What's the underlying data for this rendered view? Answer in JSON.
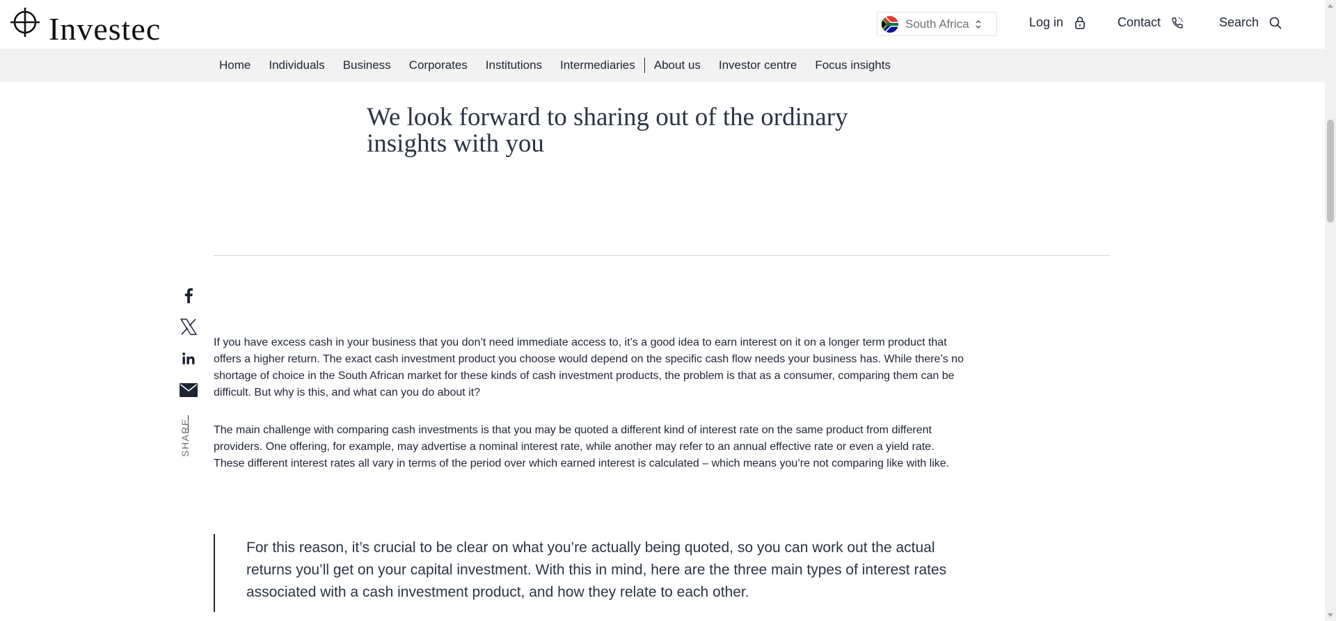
{
  "header": {
    "logo_text": "Investec",
    "region": {
      "label": "South Africa",
      "flag_icon": "south-africa-flag-icon"
    },
    "login_label": "Log in",
    "contact_label": "Contact",
    "search_label": "Search"
  },
  "nav": {
    "items": [
      {
        "label": "Home"
      },
      {
        "label": "Individuals"
      },
      {
        "label": "Business"
      },
      {
        "label": "Corporates"
      },
      {
        "label": "Institutions"
      },
      {
        "label": "Intermediaries"
      },
      {
        "label": "About us"
      },
      {
        "label": "Investor centre"
      },
      {
        "label": "Focus insights"
      }
    ]
  },
  "article": {
    "headline": "We look forward to sharing out of the ordinary insights with you",
    "paragraphs": [
      "If you have excess cash in your business that you don’t need immediate access to, it’s a good idea to earn interest on it on a longer term product that offers a higher return. The exact cash investment product you choose would depend on the specific cash flow needs your business has. While there’s no shortage of choice in the South African market for these kinds of cash investment products, the problem is that as a consumer, comparing them can be difficult. But why is this, and what can you do about it?",
      "The main challenge with comparing cash investments is that you may be quoted a different kind of interest rate on the same product from different providers. One offering, for example, may advertise a nominal interest rate, while another may refer to an annual effective rate or even a yield rate. These different interest rates all vary in terms of the period over which earned interest is calculated – which means you’re not comparing like with like."
    ],
    "quote": "For this reason, it’s crucial to be clear on what you’re actually being quoted, so you can work out the actual returns you’ll get on your capital investment. With this in mind, here are the three main types of interest rates associated with a cash investment product, and how they relate to each other."
  },
  "share": {
    "label": "SHARE",
    "icons": [
      "facebook-icon",
      "x-icon",
      "linkedin-icon",
      "email-icon"
    ]
  },
  "colors": {
    "text": "#1c2433",
    "nav_background": "#f2f2f2",
    "divider": "#d4d4d4",
    "muted": "#6b6f77"
  }
}
